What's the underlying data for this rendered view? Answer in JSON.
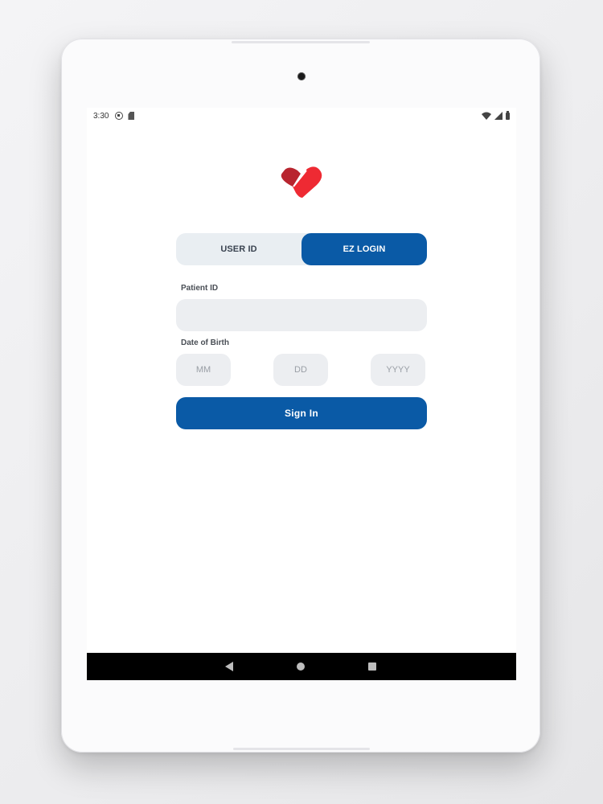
{
  "status_bar": {
    "time": "3:30"
  },
  "icons": {
    "logo": "heart-logo-icon",
    "wifi": "wifi-icon",
    "signal": "cell-signal-icon",
    "battery": "battery-icon",
    "back": "back-icon",
    "home": "home-icon",
    "recents": "recents-icon"
  },
  "colors": {
    "primary": "#0a5aa6",
    "logo_dark": "#b8252f",
    "logo_light": "#ee2a33",
    "field_bg": "#eceef1"
  },
  "login_tabs": {
    "user_id_label": "USER ID",
    "ez_login_label": "EZ LOGIN",
    "active": "EZ LOGIN"
  },
  "form": {
    "patient_id_label": "Patient ID",
    "patient_id_value": "",
    "dob_label": "Date of Birth",
    "mm_placeholder": "MM",
    "dd_placeholder": "DD",
    "yyyy_placeholder": "YYYY",
    "sign_in_label": "Sign In"
  }
}
